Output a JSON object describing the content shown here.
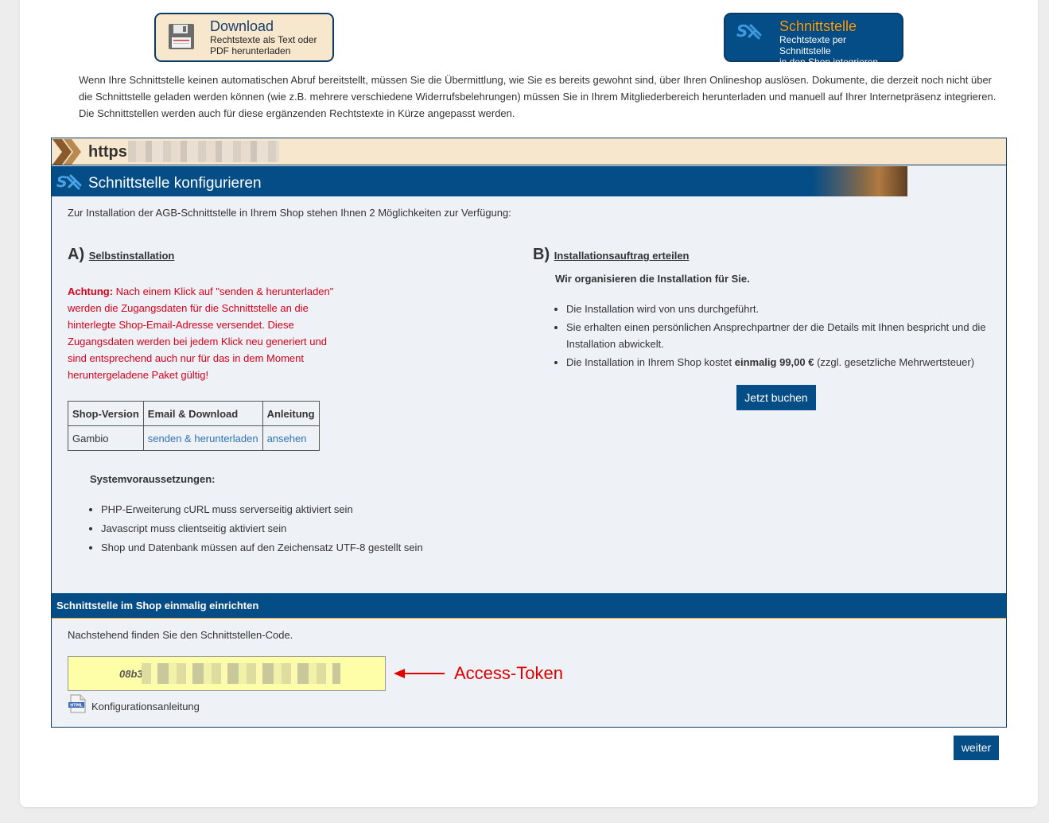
{
  "tiles": {
    "download": {
      "title": "Download",
      "line1": "Rechtstexte als Text oder",
      "line2": "PDF herunterladen"
    },
    "interface": {
      "title": "Schnittstelle",
      "line1": "Rechtstexte per Schnittstelle",
      "line2": "in den Shop integrieren"
    }
  },
  "intro": "Wenn Ihre Schnittstelle keinen automatischen Abruf bereitstellt, müssen Sie die Übermittlung, wie Sie es bereits gewohnt sind, über Ihren Onlineshop auslösen. Dokumente, die derzeit noch nicht über die Schnittstelle geladen werden können (wie z.B. mehrere verschiedene Widerrufsbelehrungen) müssen Sie in Ihrem Mitgliederbereich herunterladen und manuell auf Ihrer Internetpräsenz integrieren. Die Schnittstellen werden auch für diese ergänzenden Rechtstexte in Kürze angepasst werden.",
  "url_prefix": "https",
  "panel": {
    "title": "Schnittstelle konfigurieren",
    "intro": "Zur Installation der AGB-Schnittstelle in Ihrem Shop stehen Ihnen 2 Möglichkeiten zur Verfügung:"
  },
  "sectionA": {
    "letter": "A)",
    "title": "Selbstinstallation",
    "warning_label": "Achtung:",
    "warning_text": " Nach einem Klick auf \"senden & herunterladen\" werden die Zugangsdaten für die Schnittstelle an die hinterlegte Shop-Email-Adresse versendet. Diese Zugangsdaten werden bei jedem Klick neu generiert und sind entsprechend auch nur für das in dem Moment heruntergeladene Paket gültig!",
    "table": {
      "headers": [
        "Shop-Version",
        "Email & Download",
        "Anleitung"
      ],
      "rows": [
        {
          "version": "Gambio",
          "download": "senden & herunterladen",
          "manual": "ansehen"
        }
      ]
    },
    "requirements_title": "Systemvoraussetzungen:",
    "requirements": [
      "PHP-Erweiterung cURL muss serverseitig aktiviert sein",
      "Javascript muss clientseitig aktiviert sein",
      "Shop und Datenbank müssen auf den Zeichensatz UTF-8 gestellt sein"
    ]
  },
  "sectionB": {
    "letter": "B)",
    "title": "Installationsauftrag erteilen",
    "subtitle": "Wir organisieren die Installation für Sie.",
    "item1": "Die Installation wird von uns durchgeführt.",
    "item2": "Sie erhalten einen persönlichen Ansprechpartner der die Details mit Ihnen bespricht und die Installation abwickelt.",
    "item3_pre": "Die Installation in Ihrem Shop kostet ",
    "item3_bold": "einmalig 99,00 €",
    "item3_post": " (zzgl. gesetzliche Mehrwertsteuer)",
    "button": "Jetzt buchen"
  },
  "setup": {
    "title": "Schnittstelle im Shop einmalig einrichten",
    "info": "Nachstehend finden Sie den Schnittstellen-Code.",
    "token_prefix": "08b3",
    "annotation": "Access-Token",
    "manual_icon_text": "HTML",
    "manual_link": "Konfigurationsanleitung"
  },
  "next_button": "weiter",
  "colors": {
    "navy": "#054d86",
    "beige": "#f7e7cd",
    "warning": "#d9001b",
    "annotation": "#e00000",
    "token_bg": "#fffea8"
  }
}
